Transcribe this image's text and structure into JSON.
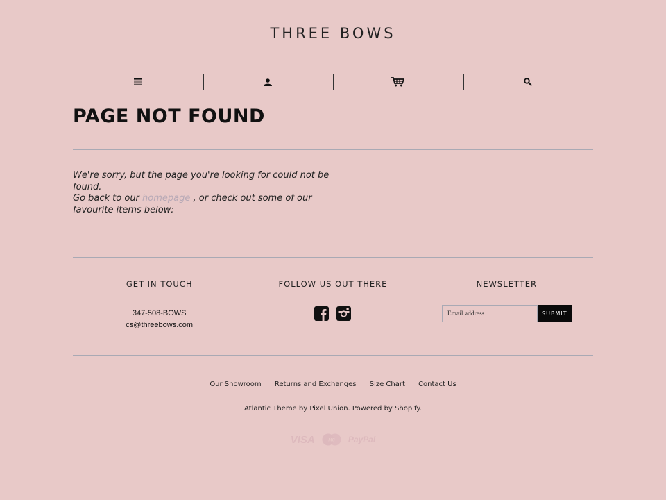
{
  "header": {
    "logo": "THREE BOWS"
  },
  "nav": {
    "items": [
      {
        "icon": "menu-icon"
      },
      {
        "icon": "account-icon"
      },
      {
        "icon": "cart-icon"
      },
      {
        "icon": "search-icon"
      }
    ]
  },
  "main": {
    "title": "PAGE NOT FOUND",
    "message_line1": "We're sorry, but the page you're looking for could not be found.",
    "message_pre": "Go back to our ",
    "homepage_link": "homepage",
    "message_post": " , or check out some of our favourite items below:"
  },
  "footer": {
    "contact": {
      "title": "GET IN TOUCH",
      "phone": "347-508-BOWS",
      "email": "cs@threebows.com"
    },
    "social": {
      "title": "FOLLOW US OUT THERE",
      "icons": [
        "facebook-icon",
        "instagram-icon"
      ]
    },
    "newsletter": {
      "title": "NEWSLETTER",
      "placeholder": "Email address",
      "submit_label": "SUBMIT"
    },
    "links": [
      "Our Showroom",
      "Returns and Exchanges",
      "Size Chart",
      "Contact Us"
    ],
    "credit": "Atlantic Theme by Pixel Union. Powered by Shopify.",
    "payments": {
      "visa": "VISA",
      "paypal": "PayPal"
    }
  },
  "colors": {
    "background": "#e8c9c8",
    "rule": "#a9a9b4",
    "button": "#0a0a0a",
    "link": "#b7a9b6"
  }
}
